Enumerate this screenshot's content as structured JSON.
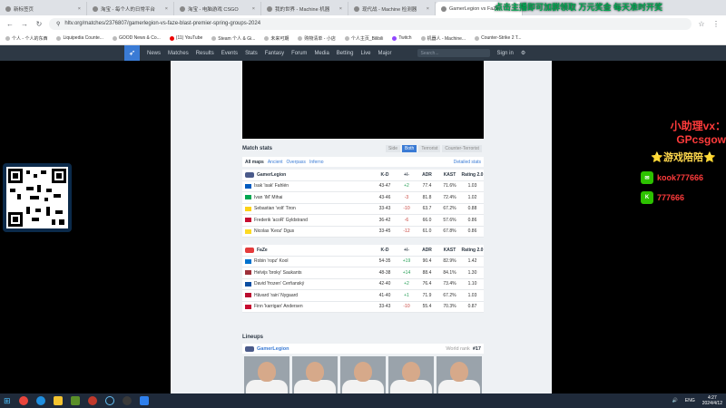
{
  "browser": {
    "tabs": [
      {
        "label": "新标签页",
        "active": false
      },
      {
        "label": "淘宝 - 每个人的日常平台",
        "active": false
      },
      {
        "label": "淘宝 - 电脑游戏 CSGO",
        "active": false
      },
      {
        "label": "我的世界 - Machine 机器",
        "active": false
      },
      {
        "label": "现代战 - Machine 检测器",
        "active": false
      },
      {
        "label": "GamerLegion vs FaZe",
        "active": true
      }
    ],
    "banner": "点击主播即可加群领取 万元奖金 每天准时开奖",
    "url": "hltv.org/matches/2376807/gamerlegion-vs-faze-blast-premier-spring-groups-2024",
    "bookmarks": [
      "个人 - 个人的东西",
      "Liquipedia Counte...",
      "GOOD News & Co...",
      "(11) YouTube",
      "Steam 个人 & Gi...",
      "未来可期",
      "购物清单 - 小店",
      "个人主页_Bilibili",
      "Twitch",
      "机器人 - Machine...",
      "Counter-Strike 2 T..."
    ]
  },
  "site": {
    "nav": [
      "News",
      "Matches",
      "Results",
      "Events",
      "Stats",
      "Fantasy",
      "Forum",
      "Media",
      "Betting",
      "Live",
      "Major"
    ],
    "search_placeholder": "Search...",
    "signin": "Sign in"
  },
  "match_stats": {
    "title": "Match stats",
    "view_tabs": [
      "Side",
      "Both",
      "Terrorist",
      "Counter-Terrorist"
    ],
    "active_tab": "Both",
    "maps_label": "All maps",
    "maps": [
      "Ancient",
      "Overpass",
      "Inferno"
    ],
    "detailed_link": "Detailed stats",
    "columns": {
      "kd": "K-D",
      "pm": "+/-",
      "adr": "ADR",
      "kast": "KAST",
      "rating": "Rating 2.0"
    },
    "teams": [
      {
        "name": "GamerLegion",
        "logo_color": "#4a5a8a",
        "players": [
          {
            "name": "Isak 'isak' Fahlén",
            "flag": "#005bbf",
            "kd": "43-47",
            "pm": "+2",
            "adr": "77.4",
            "kast": "71.6%",
            "rating": "1.03"
          },
          {
            "name": "Ivan 'iM' Mihai",
            "flag": "#00a651",
            "kd": "43-46",
            "pm": "-3",
            "adr": "81.8",
            "kast": "72.4%",
            "rating": "1.02"
          },
          {
            "name": "Sebastian 'volt' Tiron",
            "flag": "#fcd116",
            "kd": "33-43",
            "pm": "-10",
            "adr": "63.7",
            "kast": "67.2%",
            "rating": "0.88"
          },
          {
            "name": "Frederik 'acoR' Gyldstrand",
            "flag": "#c60c30",
            "kd": "36-42",
            "pm": "-6",
            "adr": "66.0",
            "kast": "57.6%",
            "rating": "0.86"
          },
          {
            "name": "Nicolas 'Keoz' Dgus",
            "flag": "#fdda24",
            "kd": "33-45",
            "pm": "-12",
            "adr": "61.0",
            "kast": "67.8%",
            "rating": "0.86"
          }
        ]
      },
      {
        "name": "FaZe",
        "logo_color": "#e43b3b",
        "players": [
          {
            "name": "Robin 'ropz' Kool",
            "flag": "#0072ce",
            "kd": "54-35",
            "pm": "+19",
            "adr": "90.4",
            "kast": "82.9%",
            "rating": "1.42"
          },
          {
            "name": "Helvijs 'broky' Saukants",
            "flag": "#9e3039",
            "kd": "48-38",
            "pm": "+14",
            "adr": "88.4",
            "kast": "84.1%",
            "rating": "1.30"
          },
          {
            "name": "David 'frozen' Čerňanský",
            "flag": "#0b4ea2",
            "kd": "42-40",
            "pm": "+2",
            "adr": "76.4",
            "kast": "73.4%",
            "rating": "1.10"
          },
          {
            "name": "Håvard 'rain' Nygaard",
            "flag": "#ba0c2f",
            "kd": "41-40",
            "pm": "+1",
            "adr": "71.9",
            "kast": "67.2%",
            "rating": "1.03"
          },
          {
            "name": "Finn 'karrigan' Andersen",
            "flag": "#c60c30",
            "kd": "33-43",
            "pm": "-10",
            "adr": "55.4",
            "kast": "70.3%",
            "rating": "0.87"
          }
        ]
      }
    ]
  },
  "lineups": {
    "title": "Lineups",
    "team": "GamerLegion",
    "rank_label": "World rank",
    "rank": "#17"
  },
  "overlay": {
    "title": "小助理vx：",
    "handle": "GPcsgow",
    "subtitle": "⭐游戏陪陪⭐",
    "contact1": "kook777666",
    "contact2": "777666",
    "icon1": "wechat-icon",
    "icon2": "kook-icon"
  },
  "taskbar": {
    "time": "4:27",
    "date": "2024/4/12",
    "lang": "ENG"
  }
}
